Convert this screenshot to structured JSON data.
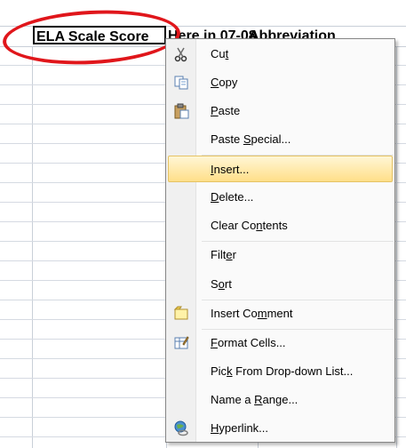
{
  "header": {
    "col1": "ELA Scale Score",
    "col2": "Here in 07-08",
    "col3": "Abbreviation"
  },
  "menu": {
    "items": [
      {
        "pre": "Cu",
        "u": "t",
        "post": "",
        "icon": "scissors-icon"
      },
      {
        "pre": "",
        "u": "C",
        "post": "opy",
        "icon": "copy-icon"
      },
      {
        "pre": "",
        "u": "P",
        "post": "aste",
        "icon": "paste-icon"
      },
      {
        "pre": "Paste ",
        "u": "S",
        "post": "pecial...",
        "icon": ""
      },
      {
        "pre": "",
        "u": "I",
        "post": "nsert...",
        "icon": ""
      },
      {
        "pre": "",
        "u": "D",
        "post": "elete...",
        "icon": ""
      },
      {
        "pre": "Clear Co",
        "u": "n",
        "post": "tents",
        "icon": ""
      },
      {
        "pre": "Filt",
        "u": "e",
        "post": "r",
        "icon": ""
      },
      {
        "pre": "S",
        "u": "o",
        "post": "rt",
        "icon": ""
      },
      {
        "pre": "Insert Co",
        "u": "m",
        "post": "ment",
        "icon": "comment-icon"
      },
      {
        "pre": "",
        "u": "F",
        "post": "ormat Cells...",
        "icon": "format-cells-icon"
      },
      {
        "pre": "Pic",
        "u": "k",
        "post": " From Drop-down List...",
        "icon": ""
      },
      {
        "pre": "Name a ",
        "u": "R",
        "post": "ange...",
        "icon": ""
      },
      {
        "pre": "",
        "u": "H",
        "post": "yperlink...",
        "icon": "hyperlink-icon"
      }
    ]
  },
  "colors": {
    "highlight_oval": "#e0161b",
    "menu_hover": "#ffdf89"
  }
}
